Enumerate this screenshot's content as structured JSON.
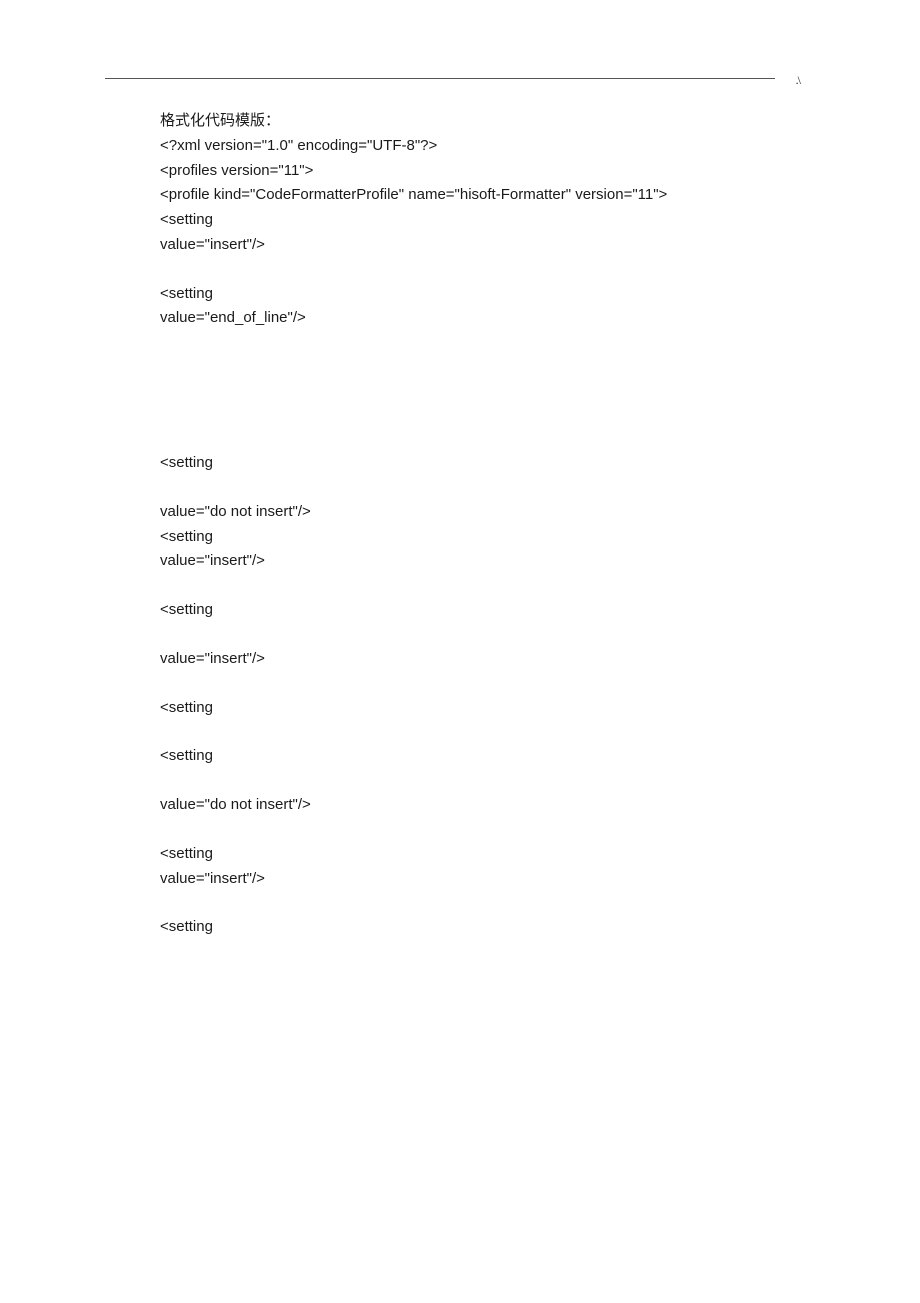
{
  "header": {
    "corner_mark": ".\\"
  },
  "body": {
    "lines": [
      {
        "text": "格式化代码模版：",
        "cjk": true
      },
      {
        "text": "<?xml version=\"1.0\" encoding=\"UTF-8\"?>"
      },
      {
        "text": "<profiles version=\"11\">"
      },
      {
        "text": "<profile kind=\"CodeFormatterProfile\" name=\"hisoft-Formatter\" version=\"11\">"
      },
      {
        "text": "<setting"
      },
      {
        "text": "value=\"insert\"/>"
      },
      {
        "blank": true
      },
      {
        "text": "<setting"
      },
      {
        "text": "value=\"end_of_line\"/>"
      },
      {
        "biggap": true
      },
      {
        "blank": true
      },
      {
        "text": "<setting"
      },
      {
        "blank": true
      },
      {
        "text": "value=\"do not insert\"/>"
      },
      {
        "text": "<setting"
      },
      {
        "text": "value=\"insert\"/>"
      },
      {
        "blank": true
      },
      {
        "text": "<setting"
      },
      {
        "blank": true
      },
      {
        "text": "value=\"insert\"/>"
      },
      {
        "blank": true
      },
      {
        "text": "<setting"
      },
      {
        "blank": true
      },
      {
        "text": "<setting"
      },
      {
        "blank": true
      },
      {
        "text": "value=\"do not insert\"/>"
      },
      {
        "blank": true
      },
      {
        "text": "<setting"
      },
      {
        "text": "value=\"insert\"/>"
      },
      {
        "blank": true
      },
      {
        "text": "<setting"
      }
    ]
  }
}
